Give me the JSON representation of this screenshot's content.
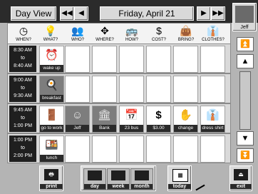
{
  "topbar": {
    "title": "Day View",
    "date": "Friday, April 21",
    "user_name": "Jeff"
  },
  "header": {
    "items": [
      {
        "label": "WHEN?",
        "icon": "clock-icon"
      },
      {
        "label": "WHAT?",
        "icon": "lightbulb-icon"
      },
      {
        "label": "WHO?",
        "icon": "people-icon"
      },
      {
        "label": "WHERE?",
        "icon": "directions-icon"
      },
      {
        "label": "HOW?",
        "icon": "bus-icon"
      },
      {
        "label": "COST?",
        "icon": "dollar-icon"
      },
      {
        "label": "BRING?",
        "icon": "bag-icon"
      },
      {
        "label": "CLOTHES?",
        "icon": "clothes-icon"
      }
    ]
  },
  "rows": [
    {
      "time_start": "8:30 AM",
      "time_to": "to",
      "time_end": "8:40 AM",
      "activities": [
        {
          "caption": "wake up",
          "icon": "alarm-clock-icon"
        }
      ]
    },
    {
      "time_start": "9:00 AM",
      "time_to": "to",
      "time_end": "9:30 AM",
      "activities": [
        {
          "caption": "breakfast",
          "icon": "breakfast-icon"
        }
      ]
    },
    {
      "time_start": "9:45 AM",
      "time_to": "to",
      "time_end": "1:00 PM",
      "activities": [
        {
          "caption": "go to work",
          "icon": "door-icon"
        },
        {
          "caption": "Jeff",
          "icon": "person-photo-icon"
        },
        {
          "caption": "Bank",
          "icon": "bank-photo-icon"
        },
        {
          "caption": "23 bus",
          "icon": "calendar-icon"
        },
        {
          "caption": "$3.00",
          "icon": "dollar-icon"
        },
        {
          "caption": "change",
          "icon": "coin-hand-icon"
        },
        {
          "caption": "dress shirt",
          "icon": "shirt-icon"
        }
      ]
    },
    {
      "time_start": "1:00 PM",
      "time_to": "to",
      "time_end": "2:00 PM",
      "activities": [
        {
          "caption": "lunch",
          "icon": "lunch-icon"
        }
      ]
    }
  ],
  "bottom": {
    "print": "print",
    "day": "day",
    "week": "week",
    "month": "month",
    "today": "today",
    "exit": "exit"
  }
}
